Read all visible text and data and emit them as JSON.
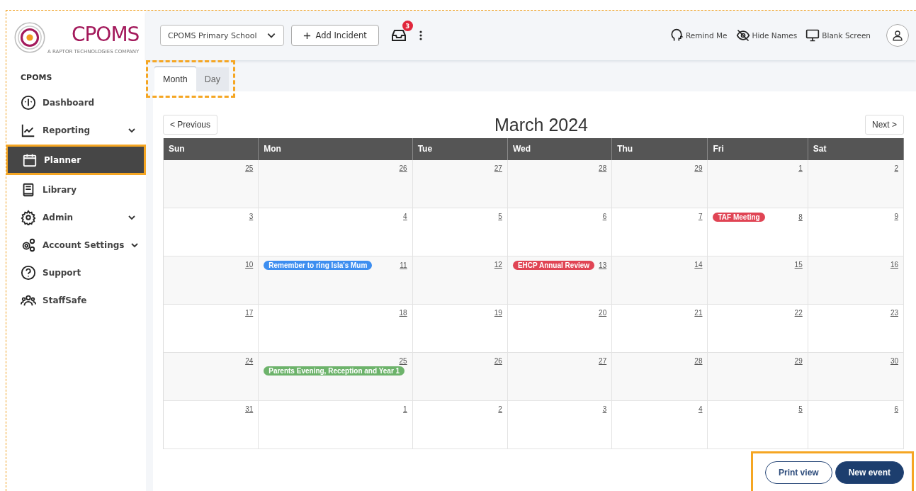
{
  "logo": {
    "name": "CPOMS",
    "tagline": "A RAPTOR TECHNOLOGIES COMPANY"
  },
  "sidebar": {
    "heading": "CPOMS",
    "items": [
      {
        "label": "Dashboard",
        "expandable": false,
        "selected": false
      },
      {
        "label": "Reporting",
        "expandable": true,
        "selected": false
      },
      {
        "label": "Planner",
        "expandable": false,
        "selected": true
      },
      {
        "label": "Library",
        "expandable": false,
        "selected": false
      },
      {
        "label": "Admin",
        "expandable": true,
        "selected": false
      },
      {
        "label": "Account Settings",
        "expandable": true,
        "selected": false
      },
      {
        "label": "Support",
        "expandable": false,
        "selected": false
      },
      {
        "label": "StaffSafe",
        "expandable": false,
        "selected": false
      }
    ]
  },
  "topbar": {
    "school": "CPOMS Primary School",
    "add_button": "Add Incident",
    "inbox_count": "3",
    "tools": [
      {
        "label": "Remind Me"
      },
      {
        "label": "Hide Names"
      },
      {
        "label": "Blank Screen"
      }
    ]
  },
  "tabs": [
    {
      "label": "Month",
      "selected": true
    },
    {
      "label": "Day",
      "selected": false
    }
  ],
  "calendar": {
    "title": "March 2024",
    "previous": "< Previous",
    "next": "Next >",
    "weekdays": [
      "Sun",
      "Mon",
      "Tue",
      "Wed",
      "Thu",
      "Fri",
      "Sat"
    ],
    "weeks": [
      [
        {
          "day": "25"
        },
        {
          "day": "26"
        },
        {
          "day": "27"
        },
        {
          "day": "28"
        },
        {
          "day": "29"
        },
        {
          "day": "1"
        },
        {
          "day": "2"
        }
      ],
      [
        {
          "day": "3"
        },
        {
          "day": "4"
        },
        {
          "day": "5"
        },
        {
          "day": "6"
        },
        {
          "day": "7"
        },
        {
          "day": "8",
          "events": [
            {
              "label": "TAF Meeting",
              "color": "#e04454"
            }
          ]
        },
        {
          "day": "9"
        }
      ],
      [
        {
          "day": "10"
        },
        {
          "day": "11",
          "events": [
            {
              "label": "Remember to ring Isla's Mum",
              "color": "#3d8ef0"
            }
          ]
        },
        {
          "day": "12"
        },
        {
          "day": "13",
          "events": [
            {
              "label": "EHCP Annual Review",
              "color": "#e04454"
            }
          ]
        },
        {
          "day": "14"
        },
        {
          "day": "15"
        },
        {
          "day": "16"
        }
      ],
      [
        {
          "day": "17"
        },
        {
          "day": "18"
        },
        {
          "day": "19"
        },
        {
          "day": "20"
        },
        {
          "day": "21"
        },
        {
          "day": "22"
        },
        {
          "day": "23"
        }
      ],
      [
        {
          "day": "24"
        },
        {
          "day": "25",
          "events": [
            {
              "label": "Parents Evening, Reception and Year 1",
              "color": "#6db36b"
            }
          ]
        },
        {
          "day": "26"
        },
        {
          "day": "27"
        },
        {
          "day": "28"
        },
        {
          "day": "29"
        },
        {
          "day": "30"
        }
      ],
      [
        {
          "day": "31"
        },
        {
          "day": "1"
        },
        {
          "day": "2"
        },
        {
          "day": "3"
        },
        {
          "day": "4"
        },
        {
          "day": "5"
        },
        {
          "day": "6"
        }
      ]
    ]
  },
  "actions": [
    "Print view",
    "New event"
  ]
}
